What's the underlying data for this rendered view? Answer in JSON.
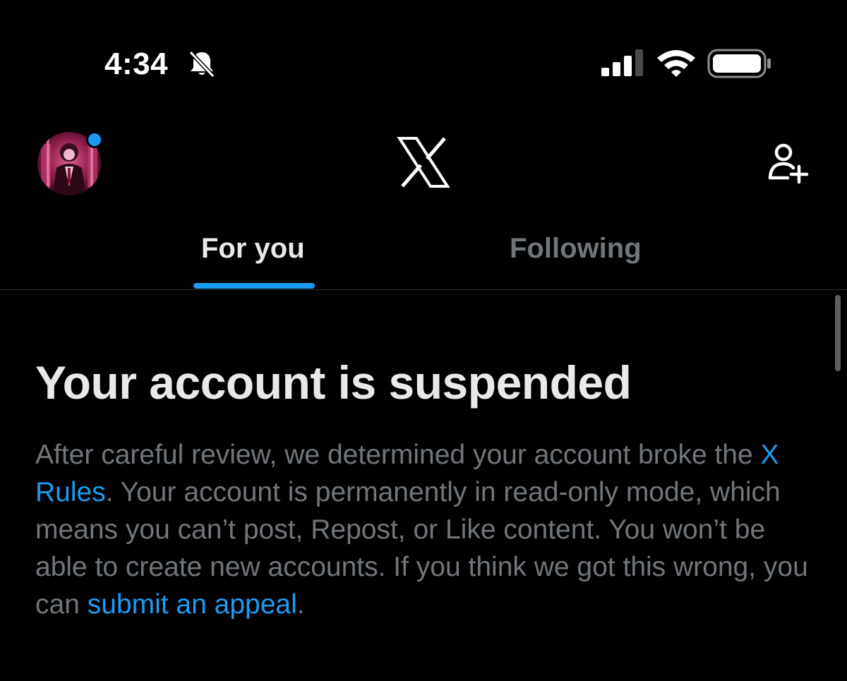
{
  "status_bar": {
    "time": "4:34",
    "icons": [
      "bell-muted-icon",
      "signal-icon",
      "wifi-icon",
      "battery-icon"
    ]
  },
  "header": {
    "avatar": "avatar",
    "logo": "x-logo-icon",
    "follow_action": "follow-user-icon"
  },
  "tabs": [
    {
      "label": "For you",
      "selected": true
    },
    {
      "label": "Following",
      "selected": false
    }
  ],
  "notice": {
    "title": "Your account is suspended",
    "body_part1": "After careful review, we determined your account broke the ",
    "rules_link": "X Rules",
    "body_part2": ". Your account is permanently in read-only mode, which means you can’t post, Repost, or Like content. You won’t be able to create new accounts. If you think we got this wrong, you can ",
    "appeal_link": "submit an appeal",
    "body_part3": "."
  },
  "colors": {
    "background": "#000000",
    "text_primary": "#e7e9ea",
    "text_secondary": "#71767b",
    "accent": "#1d9bf0"
  }
}
